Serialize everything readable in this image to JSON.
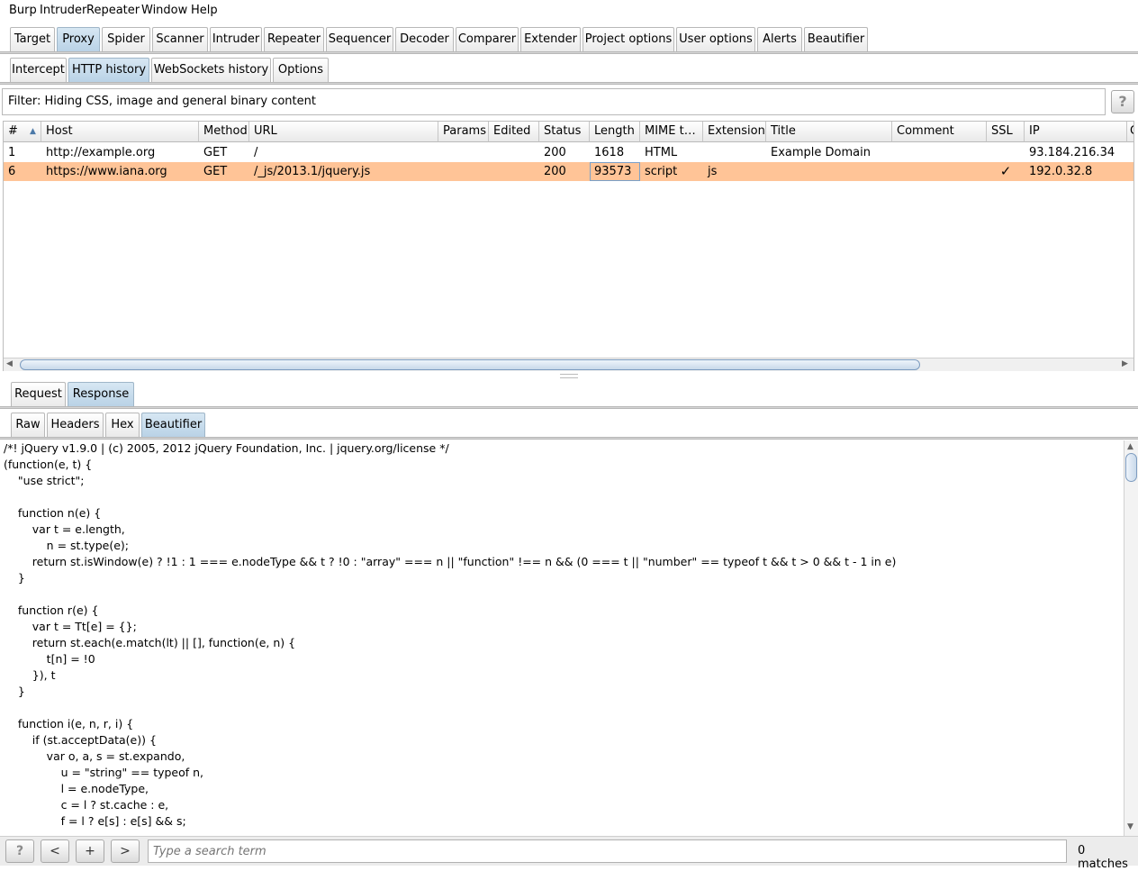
{
  "menu": [
    "Burp",
    "Intruder",
    "Repeater",
    "Window",
    "Help"
  ],
  "main_tabs": [
    "Target",
    "Proxy",
    "Spider",
    "Scanner",
    "Intruder",
    "Repeater",
    "Sequencer",
    "Decoder",
    "Comparer",
    "Extender",
    "Project options",
    "User options",
    "Alerts",
    "Beautifier"
  ],
  "main_tabs_active": "Proxy",
  "proxy_tabs": [
    "Intercept",
    "HTTP history",
    "WebSockets history",
    "Options"
  ],
  "proxy_tabs_active": "HTTP history",
  "filter_text": "Filter: Hiding CSS, image and general binary content",
  "help_label": "?",
  "table": {
    "columns": [
      "#",
      "Host",
      "Method",
      "URL",
      "Params",
      "Edited",
      "Status",
      "Length",
      "MIME t…",
      "Extension",
      "Title",
      "Comment",
      "SSL",
      "IP",
      "C"
    ],
    "sort_indicator": "▲",
    "rows": [
      {
        "num": "1",
        "host": "http://example.org",
        "method": "GET",
        "url": "/",
        "params": "",
        "edited": "",
        "status": "200",
        "length": "1618",
        "mime": "HTML",
        "extension": "",
        "title": "Example Domain",
        "comment": "",
        "ssl": "",
        "ip": "93.184.216.34",
        "selected": false
      },
      {
        "num": "6",
        "host": "https://www.iana.org",
        "method": "GET",
        "url": "/_js/2013.1/jquery.js",
        "params": "",
        "edited": "",
        "status": "200",
        "length": "93573",
        "mime": "script",
        "extension": "js",
        "title": "",
        "comment": "",
        "ssl": "✓",
        "ip": "192.0.32.8",
        "selected": true
      }
    ]
  },
  "message_tabs": [
    "Request",
    "Response"
  ],
  "message_tabs_active": "Response",
  "view_tabs": [
    "Raw",
    "Headers",
    "Hex",
    "Beautifier"
  ],
  "view_tabs_active": "Beautifier",
  "code_lines": [
    "/*! jQuery v1.9.0 | (c) 2005, 2012 jQuery Foundation, Inc. | jquery.org/license */",
    "(function(e, t) {",
    "    \"use strict\";",
    "",
    "    function n(e) {",
    "        var t = e.length,",
    "            n = st.type(e);",
    "        return st.isWindow(e) ? !1 : 1 === e.nodeType && t ? !0 : \"array\" === n || \"function\" !== n && (0 === t || \"number\" == typeof t && t > 0 && t - 1 in e)",
    "    }",
    "",
    "    function r(e) {",
    "        var t = Tt[e] = {};",
    "        return st.each(e.match(lt) || [], function(e, n) {",
    "            t[n] = !0",
    "        }), t",
    "    }",
    "",
    "    function i(e, n, r, i) {",
    "        if (st.acceptData(e)) {",
    "            var o, a, s = st.expando,",
    "                u = \"string\" == typeof n,",
    "                l = e.nodeType,",
    "                c = l ? st.cache : e,",
    "                f = l ? e[s] : e[s] && s;"
  ],
  "bottom": {
    "help": "?",
    "prev": "<",
    "add": "+",
    "next": ">",
    "search_placeholder": "Type a search term",
    "matches": "0 matches"
  }
}
